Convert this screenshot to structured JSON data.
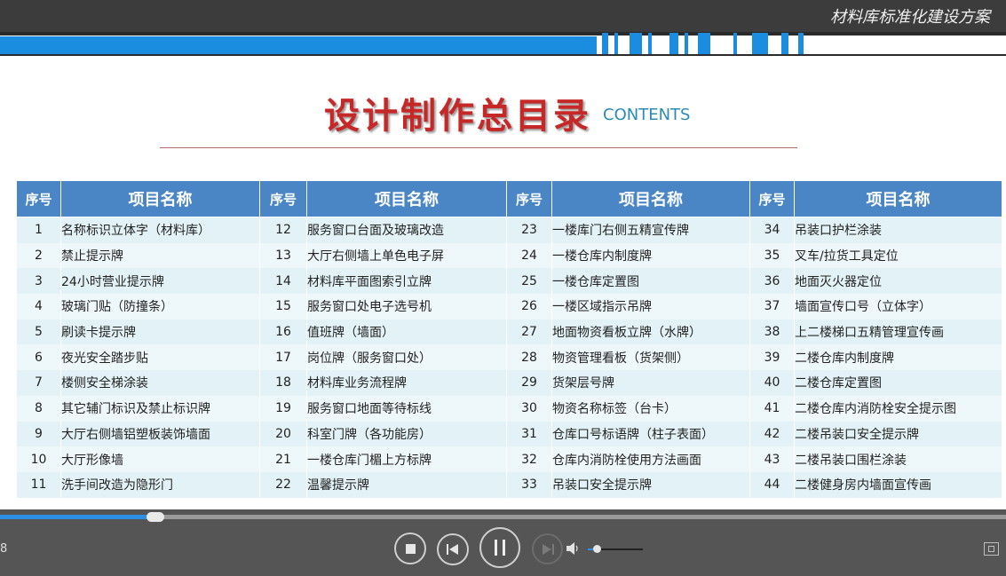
{
  "header": {
    "title": "材料库标准化建设方案"
  },
  "slide": {
    "title": "设计制作总目录",
    "subtitle": "CONTENTS",
    "table": {
      "headers": {
        "num": "序号",
        "name": "项目名称"
      },
      "rows": [
        [
          "1",
          "名称标识立体字（材料库）",
          "12",
          "服务窗口台面及玻璃改造",
          "23",
          "一楼库门右侧五精宣传牌",
          "34",
          "吊装口护栏涂装"
        ],
        [
          "2",
          "禁止提示牌",
          "13",
          "大厅右侧墙上单色电子屏",
          "24",
          "一楼仓库内制度牌",
          "35",
          "叉车/拉货工具定位"
        ],
        [
          "3",
          "24小时营业提示牌",
          "14",
          "材料库平面图索引立牌",
          "25",
          "一楼仓库定置图",
          "36",
          "地面灭火器定位"
        ],
        [
          "4",
          "玻璃门贴（防撞条）",
          "15",
          "服务窗口处电子选号机",
          "26",
          "一楼区域指示吊牌",
          "37",
          "墙面宣传口号（立体字）"
        ],
        [
          "5",
          "刷读卡提示牌",
          "16",
          "值班牌（墙面）",
          "27",
          "地面物资看板立牌（水牌）",
          "38",
          "上二楼梯口五精管理宣传画"
        ],
        [
          "6",
          "夜光安全踏步贴",
          "17",
          "岗位牌（服务窗口处）",
          "28",
          "物资管理看板（货架侧）",
          "39",
          "二楼仓库内制度牌"
        ],
        [
          "7",
          "楼侧安全梯涂装",
          "18",
          "材料库业务流程牌",
          "29",
          "货架层号牌",
          "40",
          "二楼仓库定置图"
        ],
        [
          "8",
          "其它辅门标识及禁止标识牌",
          "19",
          "服务窗口地面等待标线",
          "30",
          "物资名称标签（台卡）",
          "41",
          "二楼仓库内消防栓安全提示图"
        ],
        [
          "9",
          "大厅右侧墙铝塑板装饰墙面",
          "20",
          "科室门牌（各功能房）",
          "31",
          "仓库口号标语牌（柱子表面）",
          "42",
          "二楼吊装口安全提示牌"
        ],
        [
          "10",
          "大厅形像墙",
          "21",
          "一楼仓库门楣上方标牌",
          "32",
          "仓库内消防栓使用方法画面",
          "43",
          "二楼吊装口围栏涂装"
        ],
        [
          "11",
          "洗手间改造为隐形门",
          "22",
          "温馨提示牌",
          "33",
          "吊装口安全提示牌",
          "44",
          "二楼健身房内墙面宣传画"
        ]
      ]
    }
  },
  "player": {
    "time": "8",
    "progress": 0.155,
    "volume": 0.15,
    "colors": {
      "accent": "#2d8fe6",
      "bar": "#555555"
    },
    "controls": [
      "stop-icon",
      "previous-icon",
      "pause-icon",
      "next-icon",
      "volume-icon",
      "fullscreen-icon"
    ]
  },
  "colors": {
    "header_blue": "#4a86c6",
    "title_red": "#c62828",
    "subtitle_teal": "#2a8ab8"
  }
}
